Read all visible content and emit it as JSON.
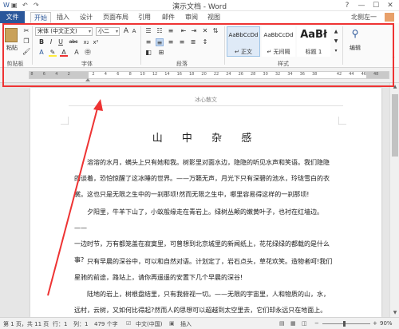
{
  "window": {
    "title": "演示文档 - Word",
    "help": "?",
    "minimize": "—",
    "maximize": "☐",
    "close": "✕"
  },
  "qat": {
    "undo": "↶",
    "redo": "↷",
    "save": "▣"
  },
  "tabs": [
    {
      "label": "文件"
    },
    {
      "label": "开始"
    },
    {
      "label": "插入"
    },
    {
      "label": "设计"
    },
    {
      "label": "页面布局"
    },
    {
      "label": "引用"
    },
    {
      "label": "邮件"
    },
    {
      "label": "审阅"
    },
    {
      "label": "视图"
    }
  ],
  "user": {
    "name": "北侧左一"
  },
  "ribbon": {
    "clipboard": {
      "paste": "粘贴",
      "label": "剪贴板"
    },
    "font": {
      "font_name": "宋体 (中文正文)",
      "font_size": "小二",
      "grow": "A",
      "shrink": "A",
      "bold": "B",
      "italic": "I",
      "underline": "U",
      "strike": "abc",
      "sub": "x₂",
      "sup": "x²",
      "label": "字体"
    },
    "paragraph": {
      "label": "段落"
    },
    "styles": {
      "items": [
        {
          "sample": "AaBbCcDd",
          "name": "↵ 正文"
        },
        {
          "sample": "AaBbCcDd",
          "name": "↵ 无间隔"
        },
        {
          "sample": "AaBł",
          "name": "标题 1"
        }
      ],
      "label": "样式"
    },
    "editing": {
      "label": "编辑"
    }
  },
  "ruler": {
    "numbers": [
      "8",
      "6",
      "4",
      "2",
      "",
      "2",
      "4",
      "6",
      "8",
      "10",
      "12",
      "14",
      "16",
      "18",
      "20",
      "22",
      "24",
      "26",
      "28",
      "30",
      "32",
      "34",
      "36",
      "38",
      "",
      "42",
      "44",
      "46",
      "48"
    ]
  },
  "document": {
    "header": "冰心散文",
    "title": "山 中 杂 感",
    "paragraphs": [
      {
        "lines": [
          "溶溶的水月，螨头上只有她和我。树影里对面水边，隐隐的听见水声和笑语。我们隐隐",
          "的谈着，恐怕惊醒了这冰睡的世界。——万籁无声，月光下只有深碧的池水，玲珑雪白的衣",
          "裳。这也只是无限之生中的一刹那顷!然而无限之生中，哪里容易得这样的一刹那顷!"
        ]
      },
      {
        "lines": [
          "夕阳里，牛羊下山了，小蚁般缘走在青岩上。绿树丛颠的嫩黄叶子，也衬在红墙边。——",
          "一边时节，万有都笼盖在寂寞里，可曾想到北京城里的新闻纸上，花花绿绿的都载的是什么",
          "事?"
        ]
      },
      {
        "lines": [
          "只有早晨的深谷中，可以和自然对语。计划定了，岩石点头，草花欢笑。造物者呵!我们",
          "星驰的前途，路站上，请你再遥遥的安置下几个早晨的深谷!"
        ]
      },
      {
        "lines": [
          "陆地的岩上，树根盘结里，只有我俯视一切。——无限的宇宙里，人和物质的山，水，",
          "远村，云树，又如何比得起?然而人的思想可以超越到太空里去，它们却永远只在地面上。"
        ]
      }
    ]
  },
  "status": {
    "page": "第 1 页，共 11 页",
    "line": "行：1",
    "col": "列：1",
    "words": "479 个字",
    "lang": "中文(中国)",
    "mode": "插入",
    "zoom": "90%"
  }
}
